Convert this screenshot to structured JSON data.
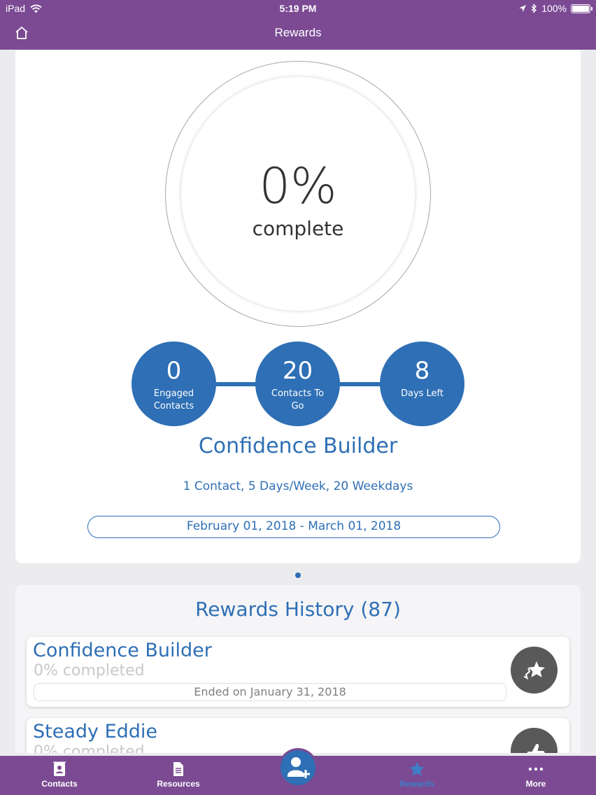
{
  "status_bar": {
    "device": "iPad",
    "time": "5:19 PM",
    "battery": "100%"
  },
  "nav": {
    "title": "Rewards"
  },
  "progress": {
    "percent": "0%",
    "label": "complete"
  },
  "stats": [
    {
      "value": "0",
      "label": "Engaged Contacts"
    },
    {
      "value": "20",
      "label": "Contacts To Go"
    },
    {
      "value": "8",
      "label": "Days Left"
    }
  ],
  "goal": {
    "title": "Confidence Builder",
    "subtitle": "1 Contact, 5 Days/Week, 20 Weekdays",
    "date_range": "February 01, 2018 - March 01, 2018"
  },
  "history": {
    "title": "Rewards History (87)",
    "items": [
      {
        "name": "Confidence Builder",
        "progress": "0% completed",
        "ended": "Ended on January 31, 2018"
      },
      {
        "name": "Steady Eddie",
        "progress": "0% completed"
      }
    ]
  },
  "tabs": [
    {
      "label": "Contacts",
      "icon": "contacts-icon"
    },
    {
      "label": "Resources",
      "icon": "document-icon"
    },
    {
      "label": "Rewards",
      "icon": "star-icon",
      "active": true
    },
    {
      "label": "More",
      "icon": "more-icon"
    }
  ],
  "colors": {
    "brand": "#7b4a93",
    "accent": "#2e6fb5",
    "badge": "#595959"
  }
}
